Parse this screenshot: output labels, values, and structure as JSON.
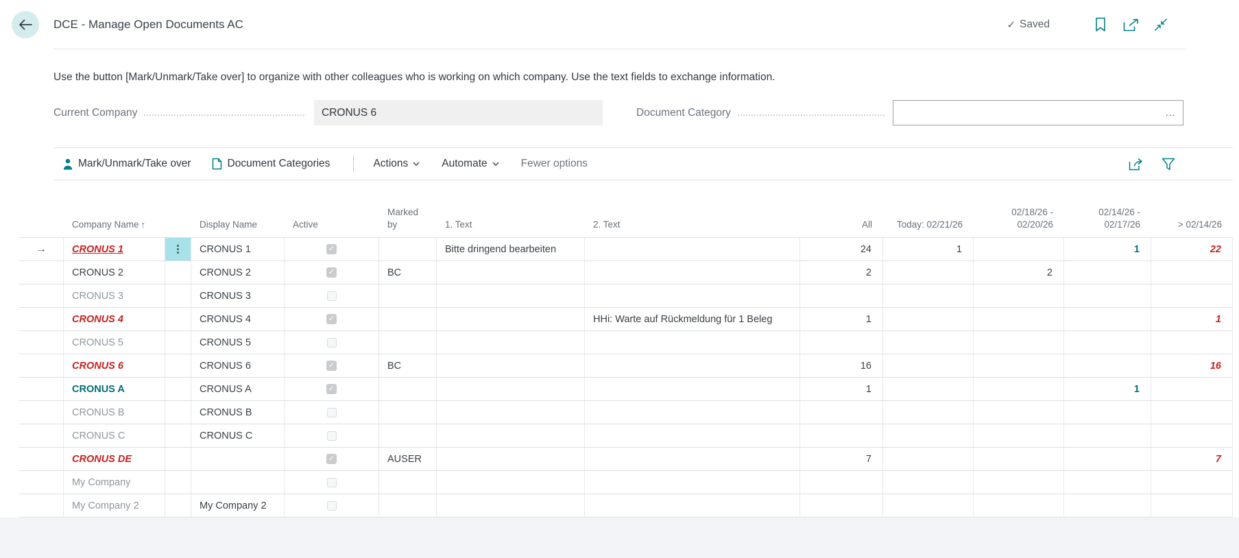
{
  "colors": {
    "accent": "#008089",
    "negative_red": "#c5221f",
    "emphasis_teal": "#006d75",
    "inactive_gray": "#8e969e",
    "focused_cell": "#a7e2e8"
  },
  "icons": {
    "back": "←",
    "saved_check": "✓",
    "menu_dots": "⋮",
    "row_arrow": "→",
    "sort_ascending": "↑",
    "ellipsis": "…",
    "bookmark": "bookmark-icon",
    "popout": "popout-icon",
    "collapse": "collapse-icon",
    "person": "person-icon",
    "document": "document-icon",
    "share": "share-icon",
    "filter": "filter-icon"
  },
  "header": {
    "title": "DCE - Manage Open Documents AC",
    "saved_label": "Saved"
  },
  "instruction": "Use the button [Mark/Unmark/Take over] to organize with other colleagues who is working on which company. Use the text fields to exchange information.",
  "fields": {
    "current_company": {
      "label": "Current Company",
      "value": "CRONUS 6"
    },
    "document_category": {
      "label": "Document Category",
      "value": "",
      "ellipsis": "…"
    }
  },
  "toolbar": {
    "mark_unmark": "Mark/Unmark/Take over",
    "document_categories": "Document Categories",
    "actions": "Actions",
    "automate": "Automate",
    "fewer_options": "Fewer options"
  },
  "table": {
    "columns": [
      {
        "key": "indicator",
        "label": ""
      },
      {
        "key": "name",
        "label": "Company Name",
        "sort": "↑"
      },
      {
        "key": "menu",
        "label": ""
      },
      {
        "key": "display",
        "label": "Display Name"
      },
      {
        "key": "active",
        "label": "Active"
      },
      {
        "key": "marked",
        "label": "Marked\nby"
      },
      {
        "key": "text1",
        "label": "1. Text"
      },
      {
        "key": "text2",
        "label": "2. Text"
      },
      {
        "key": "all",
        "label": "All",
        "align": "right"
      },
      {
        "key": "today",
        "label": "Today: 02/21/26",
        "align": "right"
      },
      {
        "key": "r1",
        "label": "02/18/26 -\n02/20/26",
        "align": "right"
      },
      {
        "key": "r2",
        "label": "02/14/26 -\n02/17/26",
        "align": "right"
      },
      {
        "key": "gt",
        "label": "> 02/14/26",
        "align": "right"
      }
    ],
    "rows": [
      {
        "indicator": "→",
        "name": {
          "v": "CRONUS 1",
          "style": "nm-red-sel"
        },
        "menu": {
          "v": "⋮",
          "focused": true
        },
        "display": "CRONUS 1",
        "active": true,
        "marked": "",
        "text1": "Bitte dringend bearbeiten",
        "text2": "",
        "all": "24",
        "today": "1",
        "r1": "",
        "r2": {
          "v": "1",
          "style": "v-teal"
        },
        "gt": {
          "v": "22",
          "style": "v-red"
        }
      },
      {
        "indicator": "",
        "name": {
          "v": "CRONUS 2",
          "style": "nm-plain"
        },
        "menu": {
          "v": ""
        },
        "display": "CRONUS 2",
        "active": true,
        "marked": "BC",
        "text1": "",
        "text2": "",
        "all": "2",
        "today": "",
        "r1": "2",
        "r2": "",
        "gt": ""
      },
      {
        "indicator": "",
        "name": {
          "v": "CRONUS 3",
          "style": "nm-inactive"
        },
        "menu": {
          "v": ""
        },
        "display": "CRONUS 3",
        "active": false,
        "marked": "",
        "text1": "",
        "text2": "",
        "all": "",
        "today": "",
        "r1": "",
        "r2": "",
        "gt": ""
      },
      {
        "indicator": "",
        "name": {
          "v": "CRONUS 4",
          "style": "nm-red"
        },
        "menu": {
          "v": ""
        },
        "display": "CRONUS 4",
        "active": true,
        "marked": "",
        "text1": "",
        "text2": "HHi: Warte auf Rückmeldung für 1 Beleg",
        "all": "1",
        "today": "",
        "r1": "",
        "r2": "",
        "gt": {
          "v": "1",
          "style": "v-red"
        }
      },
      {
        "indicator": "",
        "name": {
          "v": "CRONUS 5",
          "style": "nm-inactive"
        },
        "menu": {
          "v": ""
        },
        "display": "CRONUS 5",
        "active": false,
        "marked": "",
        "text1": "",
        "text2": "",
        "all": "",
        "today": "",
        "r1": "",
        "r2": "",
        "gt": ""
      },
      {
        "indicator": "",
        "name": {
          "v": "CRONUS 6",
          "style": "nm-red"
        },
        "menu": {
          "v": ""
        },
        "display": "CRONUS 6",
        "active": true,
        "marked": "BC",
        "text1": "",
        "text2": "",
        "all": "16",
        "today": "",
        "r1": "",
        "r2": "",
        "gt": {
          "v": "16",
          "style": "v-red"
        }
      },
      {
        "indicator": "",
        "name": {
          "v": "CRONUS A",
          "style": "nm-teal"
        },
        "menu": {
          "v": ""
        },
        "display": "CRONUS A",
        "active": true,
        "marked": "",
        "text1": "",
        "text2": "",
        "all": "1",
        "today": "",
        "r1": "",
        "r2": {
          "v": "1",
          "style": "v-teal"
        },
        "gt": ""
      },
      {
        "indicator": "",
        "name": {
          "v": "CRONUS B",
          "style": "nm-inactive"
        },
        "menu": {
          "v": ""
        },
        "display": "CRONUS B",
        "active": false,
        "marked": "",
        "text1": "",
        "text2": "",
        "all": "",
        "today": "",
        "r1": "",
        "r2": "",
        "gt": ""
      },
      {
        "indicator": "",
        "name": {
          "v": "CRONUS C",
          "style": "nm-inactive"
        },
        "menu": {
          "v": ""
        },
        "display": "CRONUS C",
        "active": false,
        "marked": "",
        "text1": "",
        "text2": "",
        "all": "",
        "today": "",
        "r1": "",
        "r2": "",
        "gt": ""
      },
      {
        "indicator": "",
        "name": {
          "v": "CRONUS DE",
          "style": "nm-red"
        },
        "menu": {
          "v": ""
        },
        "display": "",
        "active": true,
        "marked": "AUSER",
        "text1": "",
        "text2": "",
        "all": "7",
        "today": "",
        "r1": "",
        "r2": "",
        "gt": {
          "v": "7",
          "style": "v-red"
        }
      },
      {
        "indicator": "",
        "name": {
          "v": "My Company",
          "style": "nm-inactive"
        },
        "menu": {
          "v": ""
        },
        "display": "",
        "active": false,
        "marked": "",
        "text1": "",
        "text2": "",
        "all": "",
        "today": "",
        "r1": "",
        "r2": "",
        "gt": ""
      },
      {
        "indicator": "",
        "name": {
          "v": "My Company 2",
          "style": "nm-inactive"
        },
        "menu": {
          "v": ""
        },
        "display": "My Company 2",
        "active": false,
        "marked": "",
        "text1": "",
        "text2": "",
        "all": "",
        "today": "",
        "r1": "",
        "r2": "",
        "gt": ""
      }
    ]
  }
}
